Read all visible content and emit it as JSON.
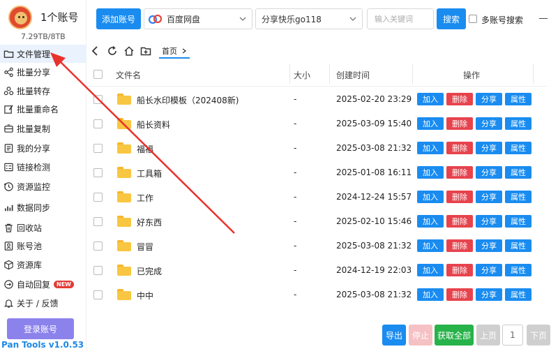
{
  "account": {
    "count_label": "1个账号",
    "storage": "7.29TB/8TB"
  },
  "sidebar": {
    "items": [
      {
        "label": "文件管理",
        "icon": "folder-icon"
      },
      {
        "label": "批量分享",
        "icon": "share-icon"
      },
      {
        "label": "批量转存",
        "icon": "transfer-icon"
      },
      {
        "label": "批量重命名",
        "icon": "rename-icon"
      },
      {
        "label": "批量复制",
        "icon": "copy-icon"
      },
      {
        "label": "我的分享",
        "icon": "my-share-icon"
      },
      {
        "label": "链接检测",
        "icon": "link-check-icon"
      },
      {
        "label": "资源监控",
        "icon": "monitor-icon"
      },
      {
        "label": "数据同步",
        "icon": "sync-icon"
      },
      {
        "label": "回收站",
        "icon": "trash-icon"
      },
      {
        "label": "账号池",
        "icon": "account-pool-icon"
      },
      {
        "label": "资源库",
        "icon": "library-icon"
      },
      {
        "label": "自动回复",
        "icon": "auto-reply-icon",
        "badge": "NEW"
      },
      {
        "label": "关于 / 反馈",
        "icon": "bell-icon"
      }
    ],
    "login_label": "登录账号",
    "version": "Pan Tools v1.0.53"
  },
  "toolbar": {
    "add_account_label": "添加账号",
    "drive_select": "百度网盘",
    "account_select": "分享快乐go118",
    "search_placeholder": "输入关键词",
    "search_label": "搜索",
    "multi_search_label": "多账号搜索"
  },
  "path": {
    "breadcrumb": "首页"
  },
  "table": {
    "headers": {
      "name": "文件名",
      "size": "大小",
      "time": "创建时间",
      "actions": "操作"
    },
    "action_labels": {
      "add": "加入",
      "delete": "删除",
      "share": "分享",
      "props": "属性"
    },
    "rows": [
      {
        "name": "船长水印模板（202408新)",
        "size": "-",
        "time": "2025-02-20 23:29"
      },
      {
        "name": "船长资料",
        "size": "-",
        "time": "2025-03-09 15:40"
      },
      {
        "name": "福福",
        "size": "-",
        "time": "2025-03-08 21:32"
      },
      {
        "name": "工具箱",
        "size": "-",
        "time": "2025-01-08 16:11"
      },
      {
        "name": "工作",
        "size": "-",
        "time": "2024-12-24 15:57"
      },
      {
        "name": "好东西",
        "size": "-",
        "time": "2025-02-10 15:46"
      },
      {
        "name": "冒冒",
        "size": "-",
        "time": "2025-03-08 21:32"
      },
      {
        "name": "已完成",
        "size": "-",
        "time": "2024-12-19 22:03"
      },
      {
        "name": "中中",
        "size": "-",
        "time": "2025-03-08 21:32"
      }
    ]
  },
  "footer": {
    "export": "导出",
    "stop": "停止",
    "fetch_all": "获取全部",
    "prev": "上页",
    "page": "1",
    "next": "下页"
  },
  "colors": {
    "accent": "#1a8cf0",
    "danger": "#e7434d",
    "success": "#27b24a",
    "login": "#8c82ec",
    "arrow": "#e8322b"
  }
}
